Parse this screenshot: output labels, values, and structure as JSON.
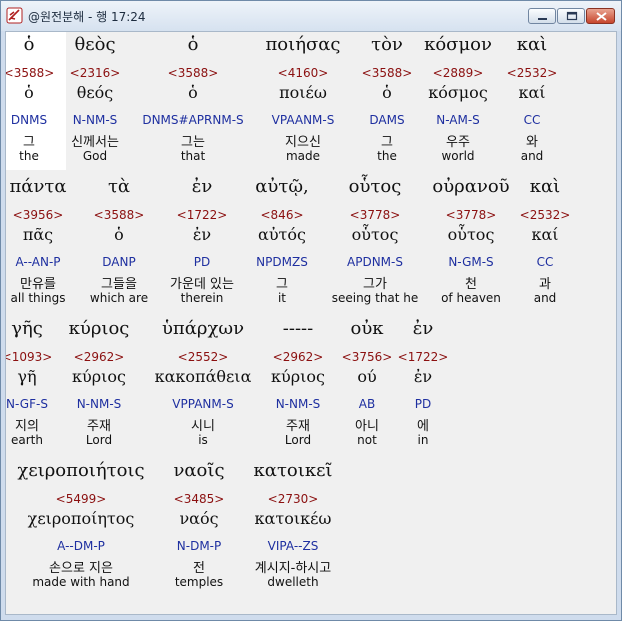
{
  "window": {
    "title": "@원전분해 - 행 17:24"
  },
  "title_buttons": {
    "minimize": "minimize-icon",
    "maximize": "maximize-icon",
    "close": "close-icon"
  },
  "lines": [
    [
      {
        "greek": "ὁ",
        "strong": "<3588>",
        "lemma": "ὁ",
        "parse": "DNMS",
        "korean": "그",
        "english": "the"
      },
      {
        "greek": "θεὸς",
        "strong": "<2316>",
        "lemma": "θεός",
        "parse": "N-NM-S",
        "korean": "신께서는",
        "english": "God"
      },
      {
        "greek": "ὁ",
        "strong": "<3588>",
        "lemma": "ὁ",
        "parse": "DNMS#APRNM-S",
        "korean": "그는",
        "english": "that"
      },
      {
        "greek": "ποιήσας",
        "strong": "<4160>",
        "lemma": "ποιέω",
        "parse": "VPAANM-S",
        "korean": "지으신",
        "english": "made"
      },
      {
        "greek": "τὸν",
        "strong": "<3588>",
        "lemma": "ὁ",
        "parse": "DAMS",
        "korean": "그",
        "english": "the"
      },
      {
        "greek": "κόσμον",
        "strong": "<2889>",
        "lemma": "κόσμος",
        "parse": "N-AM-S",
        "korean": "우주",
        "english": "world"
      },
      {
        "greek": "καὶ",
        "strong": "<2532>",
        "lemma": "καί",
        "parse": "CC",
        "korean": "와",
        "english": "and"
      }
    ],
    [
      {
        "greek": "πάντα",
        "strong": "<3956>",
        "lemma": "πᾶς",
        "parse": "A--AN-P",
        "korean": "만유를",
        "english": "all things"
      },
      {
        "greek": "τὰ",
        "strong": "<3588>",
        "lemma": "ὁ",
        "parse": "DANP",
        "korean": "그들을",
        "english": "which are"
      },
      {
        "greek": "ἐν",
        "strong": "<1722>",
        "lemma": "ἐν",
        "parse": "PD",
        "korean": "가운데 있는",
        "english": "therein"
      },
      {
        "greek": "αὐτῷ,",
        "strong": "<846>",
        "lemma": "αὐτός",
        "parse": "NPDMZS",
        "korean": "그",
        "english": "it"
      },
      {
        "greek": "οὗτος",
        "strong": "<3778>",
        "lemma": "οὗτος",
        "parse": "APDNM-S",
        "korean": "그가",
        "english": "seeing that he"
      },
      {
        "greek": "οὐρανοῦ",
        "strong": "<3778>",
        "lemma": "οὗτος",
        "parse": "N-GM-S",
        "korean": "천",
        "english": "of heaven"
      },
      {
        "greek": "καὶ",
        "strong": "<2532>",
        "lemma": "καί",
        "parse": "CC",
        "korean": "과",
        "english": "and"
      }
    ],
    [
      {
        "greek": "γῆς",
        "strong": "<1093>",
        "lemma": "γῆ",
        "parse": "N-GF-S",
        "korean": "지의",
        "english": "earth"
      },
      {
        "greek": "κύριος",
        "strong": "<2962>",
        "lemma": "κύριος",
        "parse": "N-NM-S",
        "korean": "주재",
        "english": "Lord"
      },
      {
        "greek": "ὑπάρχων",
        "strong": "<2552>",
        "lemma": "κακοπάθεια",
        "parse": "VPPANM-S",
        "korean": "시니",
        "english": "is"
      },
      {
        "greek": "-----",
        "strong": "<2962>",
        "lemma": "κύριος",
        "parse": "N-NM-S",
        "korean": "주재",
        "english": "Lord"
      },
      {
        "greek": "οὐκ",
        "strong": "<3756>",
        "lemma": "ού",
        "parse": "AB",
        "korean": "아니",
        "english": "not"
      },
      {
        "greek": "ἐν",
        "strong": "<1722>",
        "lemma": "ἐν",
        "parse": "PD",
        "korean": "에",
        "english": "in"
      }
    ],
    [
      {
        "greek": "χειροποιήτοις",
        "strong": "<5499>",
        "lemma": "χειροποίητος",
        "parse": "A--DM-P",
        "korean": "손으로 지은",
        "english": "made with hand"
      },
      {
        "greek": "ναοῖς",
        "strong": "<3485>",
        "lemma": "ναός",
        "parse": "N-DM-P",
        "korean": "전",
        "english": "temples"
      },
      {
        "greek": "κατοικεῖ",
        "strong": "<2730>",
        "lemma": "κατοικέω",
        "parse": "VIPA--ZS",
        "korean": "계시지-하시고",
        "english": "dwelleth"
      }
    ]
  ]
}
